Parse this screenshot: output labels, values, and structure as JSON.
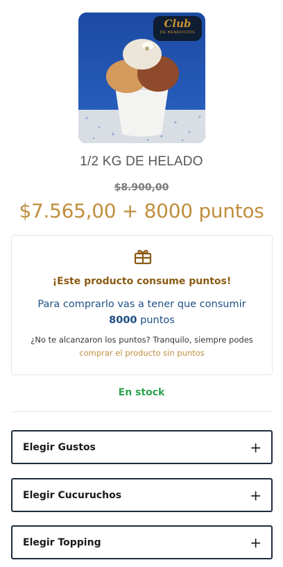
{
  "product": {
    "title": "1/2 KG DE HELADO",
    "old_price": "$8.900,00",
    "price": "$7.565,00 + 8000 puntos",
    "image_icon": "ice-cream-cup-image"
  },
  "club_badge": {
    "title": "Club",
    "subtitle": "DE BENEFICIOS"
  },
  "points_box": {
    "icon": "gift-icon",
    "heading": "¡Este producto consume puntos!",
    "text_before": "Para comprarlo vas a tener que consumir",
    "points_amount": "8000",
    "text_after": "puntos",
    "help_text": "¿No te alcanzaron los puntos? Tranquilo, siempre podes",
    "link_text": "comprar el producto sin puntos"
  },
  "stock_status": "En stock",
  "options": [
    {
      "label": "Elegir Gustos",
      "icon": "plus-icon"
    },
    {
      "label": "Elegir Cucuruchos",
      "icon": "plus-icon"
    },
    {
      "label": "Elegir Topping",
      "icon": "plus-icon"
    }
  ],
  "colors": {
    "accent_gold": "#c08e3e",
    "heading_brown": "#8a5a14",
    "points_blue": "#1c4f83",
    "stock_green": "#2ea24f",
    "border_dark": "#1e2a3d"
  }
}
